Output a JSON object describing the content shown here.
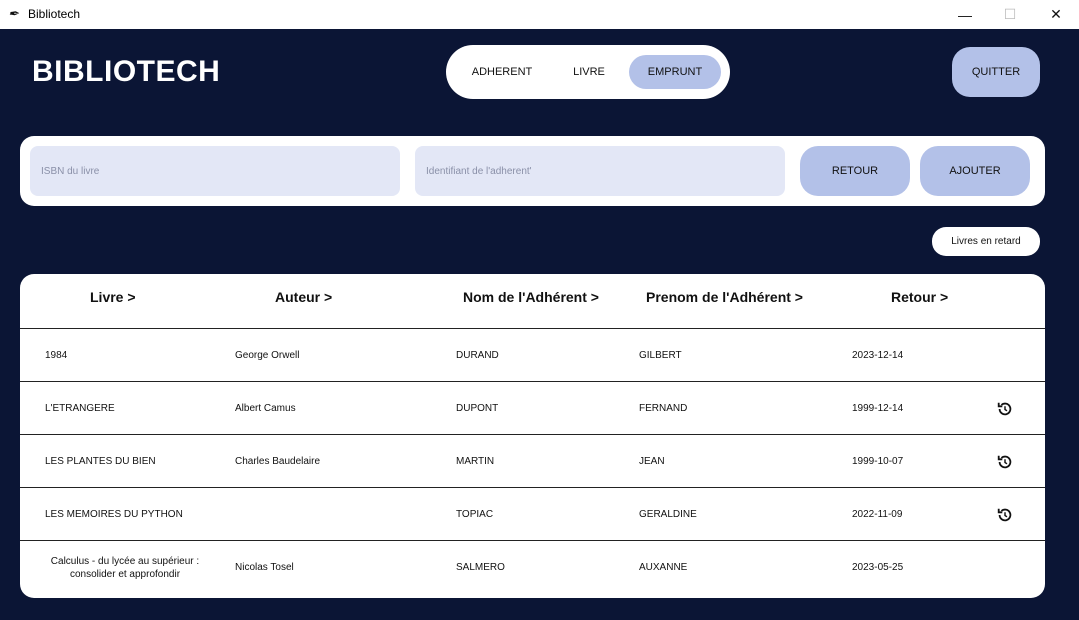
{
  "window": {
    "title": "Bibliotech",
    "min_glyph": "—",
    "max_glyph": "☐",
    "close_glyph": "✕",
    "app_icon": "feather-icon"
  },
  "header": {
    "brand": "BIBLIOTECH",
    "quit_label": "QUITTER"
  },
  "nav": {
    "tabs": [
      {
        "label": "ADHERENT",
        "active": false
      },
      {
        "label": "LIVRE",
        "active": false
      },
      {
        "label": "EMPRUNT",
        "active": true
      }
    ]
  },
  "form": {
    "isbn_placeholder": "ISBN du livre",
    "member_placeholder": "Identifiant de l'adherent'",
    "retour_label": "RETOUR",
    "ajouter_label": "AJOUTER"
  },
  "late_button_label": "Livres en retard",
  "table": {
    "headers": [
      "Livre >",
      "Auteur >",
      "Nom de l'Adhérent >",
      "Prenom de l'Adhérent >",
      "Retour >"
    ],
    "rows": [
      {
        "livre": "1984",
        "auteur": "George Orwell",
        "nom": "DURAND",
        "prenom": "GILBERT",
        "retour": "2023-12-14",
        "action_icon": ""
      },
      {
        "livre": "L'ETRANGERE",
        "auteur": "Albert Camus",
        "nom": "DUPONT",
        "prenom": "FERNAND",
        "retour": "1999-12-14",
        "action_icon": "return-refresh-icon"
      },
      {
        "livre": "LES PLANTES DU BIEN",
        "auteur": "Charles Baudelaire",
        "nom": "MARTIN",
        "prenom": "JEAN",
        "retour": "1999-10-07",
        "action_icon": "return-refresh-icon"
      },
      {
        "livre": "LES MEMOIRES DU PYTHON",
        "auteur": "",
        "nom": "TOPIAC",
        "prenom": "GERALDINE",
        "retour": "2022-11-09",
        "action_icon": "return-refresh-icon"
      },
      {
        "livre": "Calculus - du lycée au supérieur : consolider et approfondir",
        "auteur": "Nicolas Tosel",
        "nom": "SALMERO",
        "prenom": "AUXANNE",
        "retour": "2023-05-25",
        "action_icon": ""
      }
    ]
  },
  "colors": {
    "background": "#0b1535",
    "accent": "#b3c1e8",
    "field": "#e3e7f6"
  }
}
